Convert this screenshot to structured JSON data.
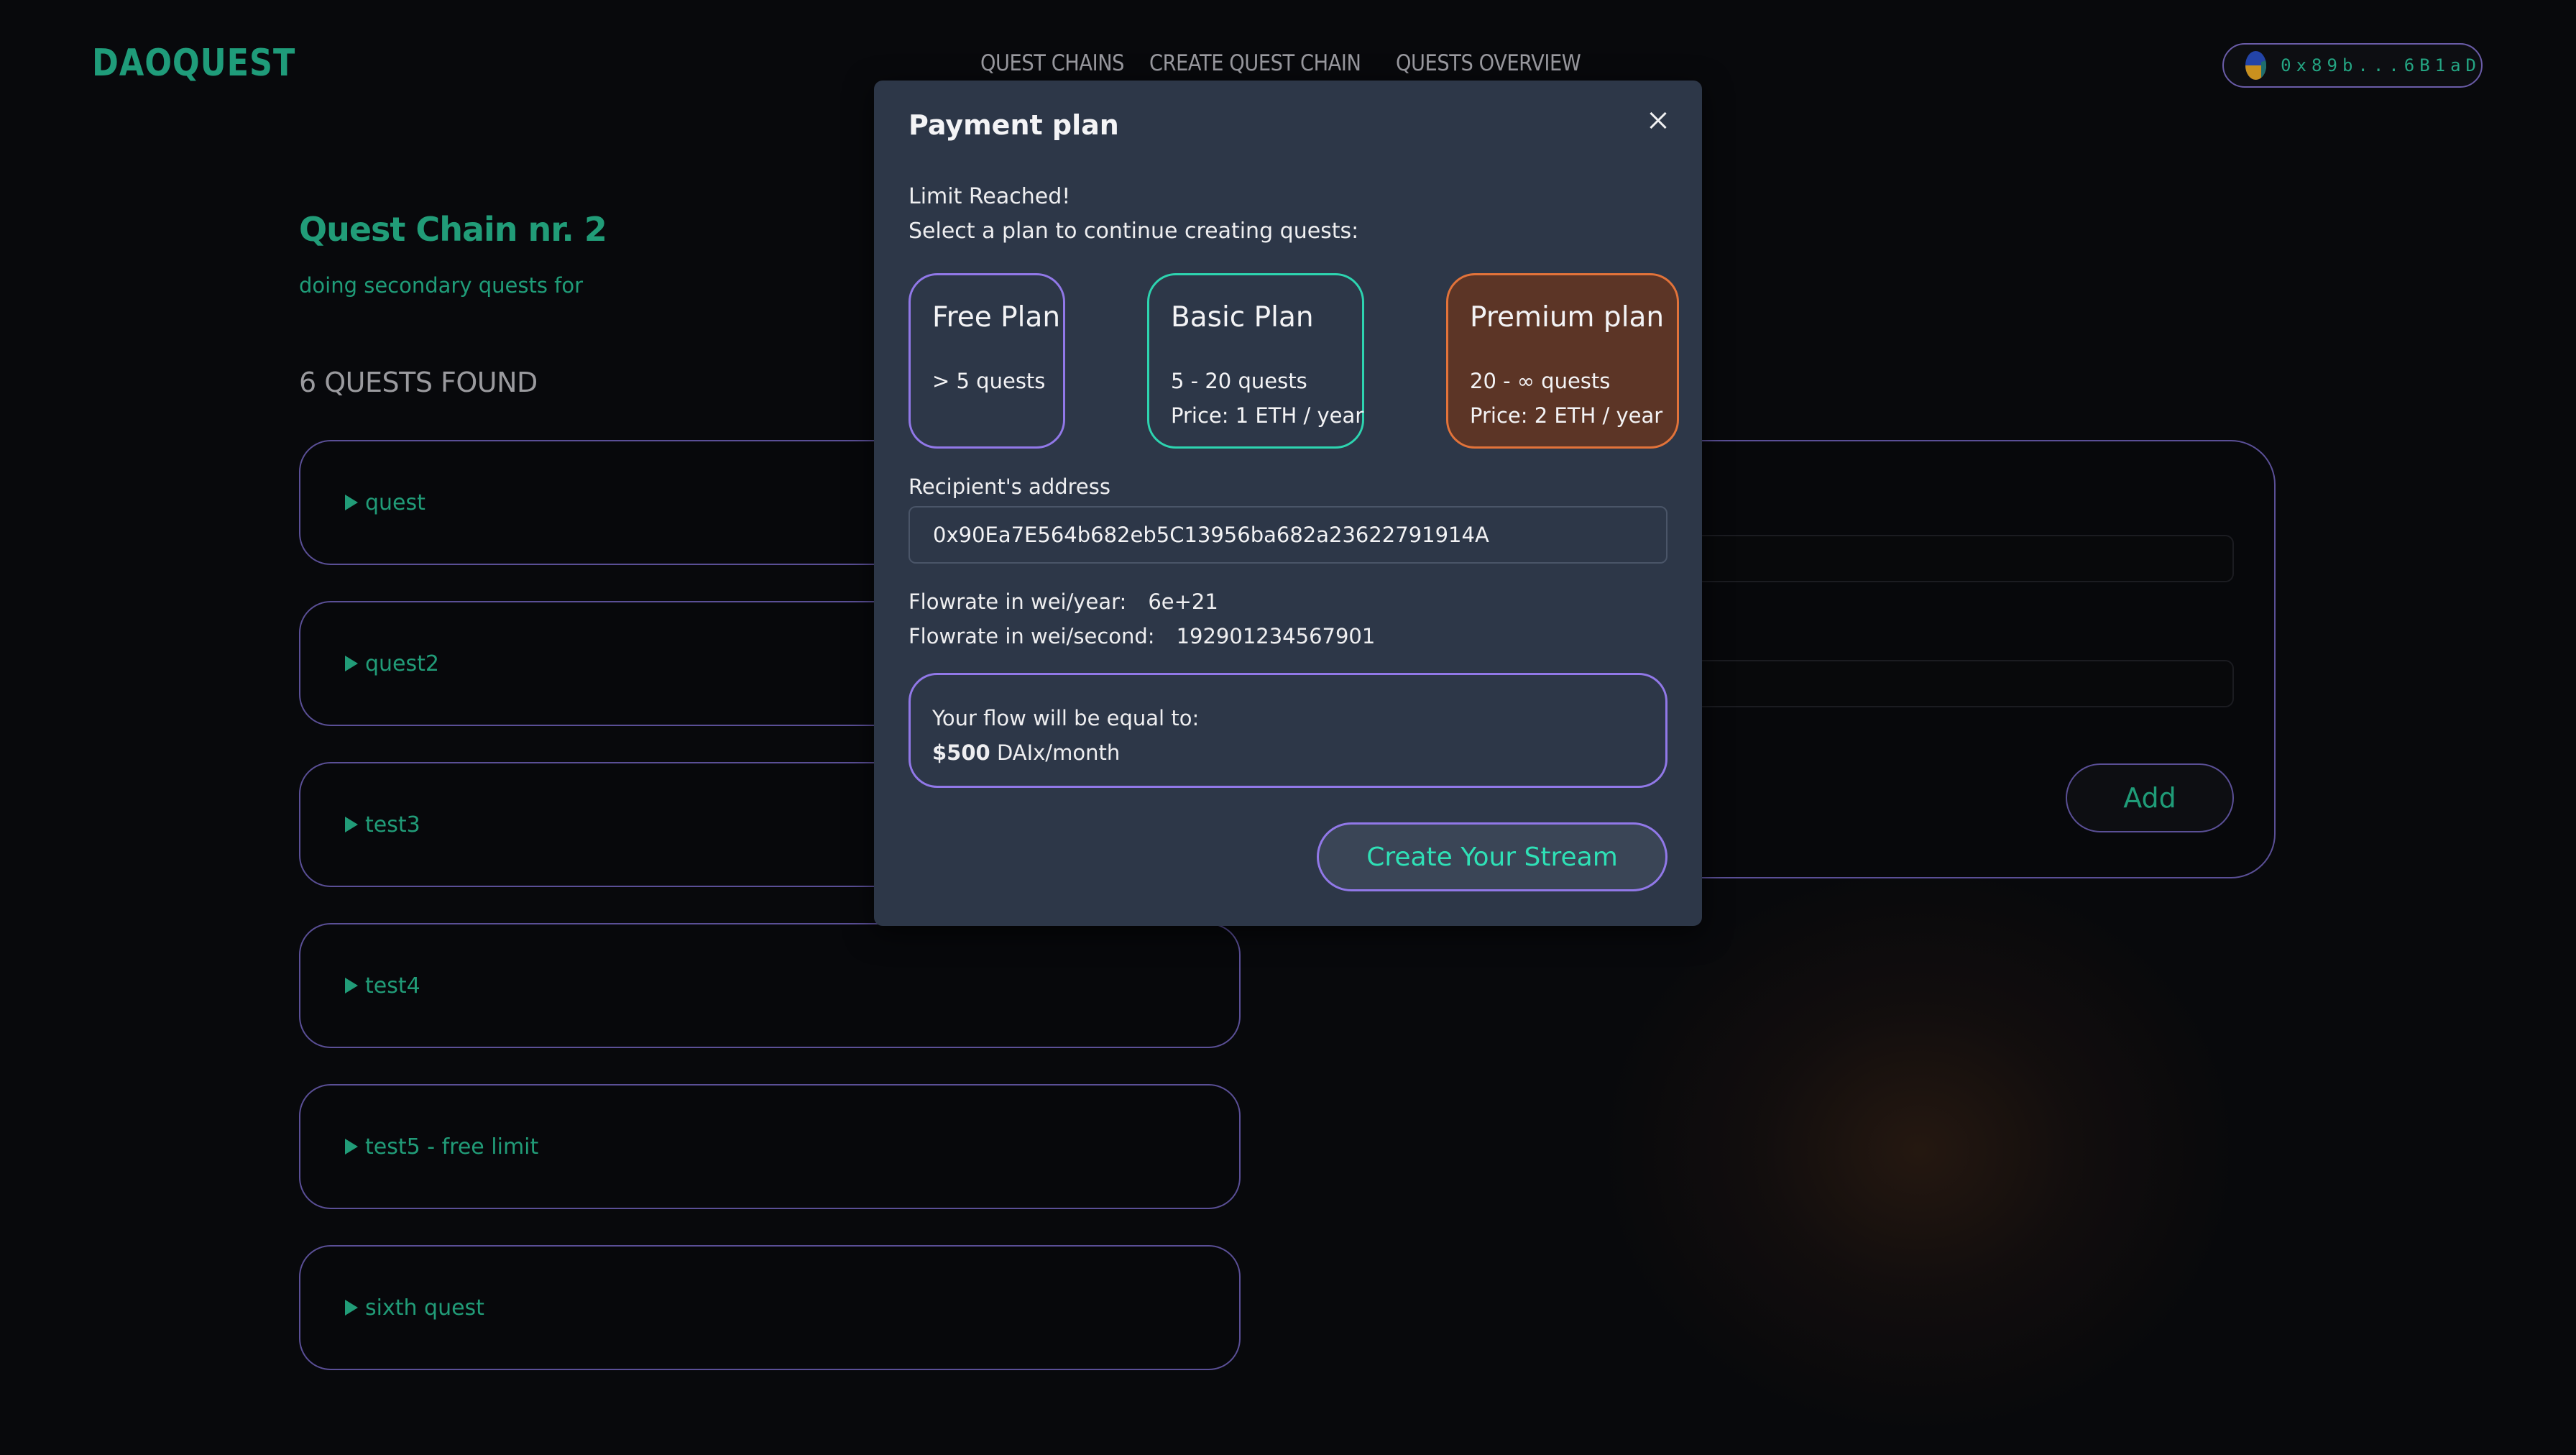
{
  "header": {
    "logo": "DAOQUEST",
    "nav": [
      "QUEST CHAINS",
      "CREATE QUEST CHAIN",
      "QUESTS OVERVIEW"
    ],
    "wallet": {
      "address": "0x89b...6B1aD",
      "avatar_icon": "jazzicon-avatar"
    }
  },
  "chain": {
    "title": "Quest Chain nr. 2",
    "description": "doing secondary quests for",
    "found_label": "6 QUESTS FOUND",
    "quests": [
      "quest",
      "quest2",
      "test3",
      "test4",
      "test5 - free limit",
      "sixth quest"
    ]
  },
  "create_panel": {
    "add_label": "Add",
    "name_input": {
      "value": "",
      "placeholder": ""
    },
    "description_input": {
      "value": "",
      "placeholder": ""
    }
  },
  "modal": {
    "title": "Payment plan",
    "close_icon": "close-icon",
    "limit_text": "Limit Reached!",
    "select_text": "Select a plan to continue creating quests:",
    "plans": [
      {
        "name": "Free Plan",
        "range": "> 5 quests",
        "price": "",
        "color": "#9178e8"
      },
      {
        "name": "Basic Plan",
        "range": "5 - 20 quests",
        "price": "Price: 1 ETH / year",
        "color": "#2dd4b0"
      },
      {
        "name": "Premium plan",
        "range": "20 - ∞ quests",
        "price": "Price: 2 ETH / year",
        "color": "#e2733a"
      }
    ],
    "recipient_label": "Recipient's address",
    "recipient_value": "0x90Ea7E564b682eb5C13956ba682a23622791914A",
    "flow_year_label": "Flowrate in wei/year:",
    "flow_year_value": "6e+21",
    "flow_second_label": "Flowrate in wei/second:",
    "flow_second_value": "192901234567901",
    "flow_equal_label": "Your flow will be equal to:",
    "flow_amount": "$500",
    "flow_unit": "DAIx/month",
    "submit_label": "Create Your Stream"
  },
  "colors": {
    "brand_green": "#219c78",
    "accent_purple": "#9178e8",
    "accent_teal": "#2dd4b0",
    "accent_orange": "#e2733a",
    "modal_bg": "#2d3748"
  }
}
